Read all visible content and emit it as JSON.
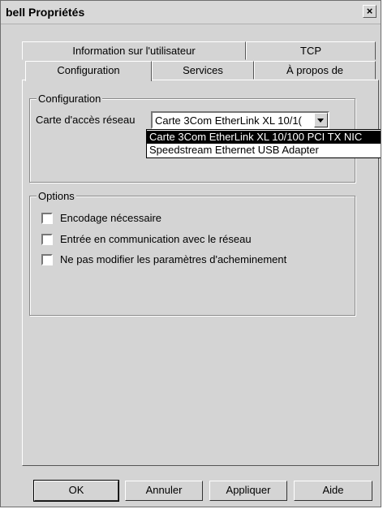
{
  "window": {
    "title": "bell Propriétés",
    "close_glyph": "×"
  },
  "tabs": {
    "row_back": [
      "Information sur l'utilisateur",
      "TCP"
    ],
    "row_front": [
      "Configuration",
      "Services",
      "À propos de"
    ],
    "active": "Configuration"
  },
  "configuration": {
    "group_label": "Configuration",
    "adapter_label": "Carte d'accès réseau",
    "adapter_value": "Carte 3Com EtherLink XL 10/1(",
    "adapter_options": [
      "Carte 3Com EtherLink XL 10/100 PCI TX NIC",
      "Speedstream Ethernet USB Adapter"
    ]
  },
  "options": {
    "group_label": "Options",
    "items": [
      {
        "label": "Encodage nécessaire",
        "checked": false
      },
      {
        "label": "Entrée en communication avec le réseau",
        "checked": false
      },
      {
        "label": "Ne pas modifier les paramètres d'acheminement",
        "checked": false
      }
    ]
  },
  "buttons": {
    "ok": "OK",
    "cancel": "Annuler",
    "apply": "Appliquer",
    "help": "Aide"
  }
}
